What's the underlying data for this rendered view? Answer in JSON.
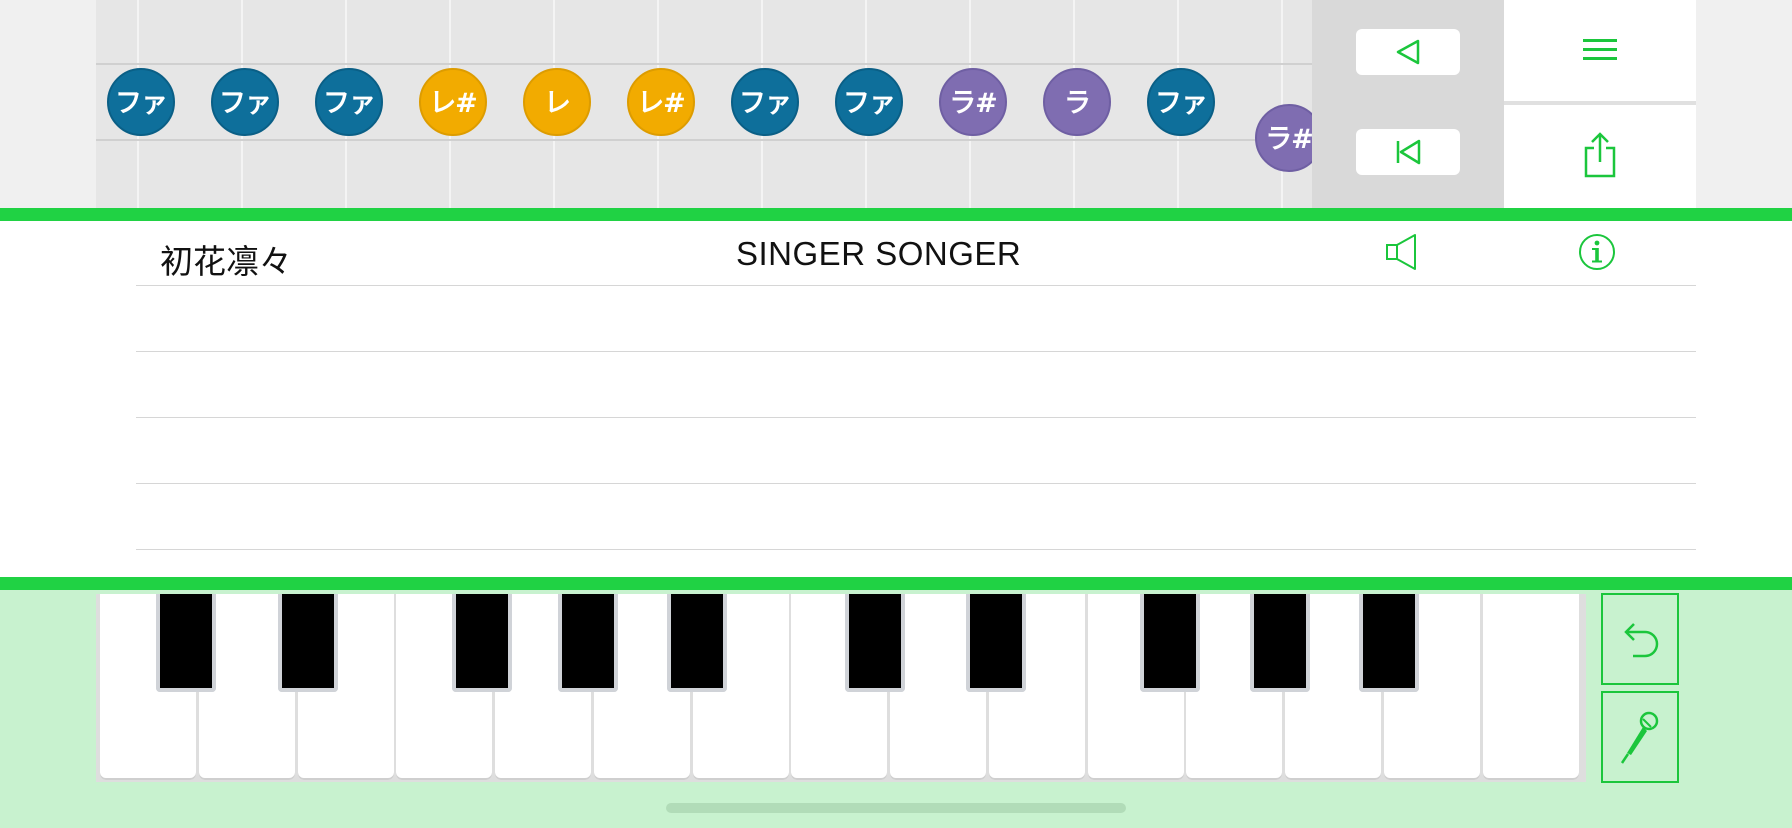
{
  "colors": {
    "accent_green": "#20d244",
    "note_blue": "#0e6f9b",
    "note_yellow": "#f2ab00",
    "note_purple": "#7f6db1"
  },
  "roll": {
    "notes": [
      "ファ",
      "ファ",
      "ファ",
      "レ#",
      "レ",
      "レ#",
      "ファ",
      "ファ",
      "ラ#",
      "ラ",
      "ファ",
      "ラ#"
    ],
    "note_colors": [
      "blue",
      "blue",
      "blue",
      "yellow",
      "yellow",
      "yellow",
      "blue",
      "blue",
      "purple",
      "purple",
      "blue",
      "purple"
    ]
  },
  "controls": {
    "play_icon": "triangle-left-icon",
    "rewind_icon": "skip-to-start-icon",
    "menu_icon": "hamburger-menu-icon",
    "share_icon": "share-icon"
  },
  "song": {
    "artist": "初花凛々",
    "title": "SINGER SONGER",
    "speaker_icon": "speaker-icon",
    "info_icon": "info-icon"
  },
  "keyboard": {
    "undo_icon": "undo-icon",
    "mic_icon": "microphone-icon"
  }
}
